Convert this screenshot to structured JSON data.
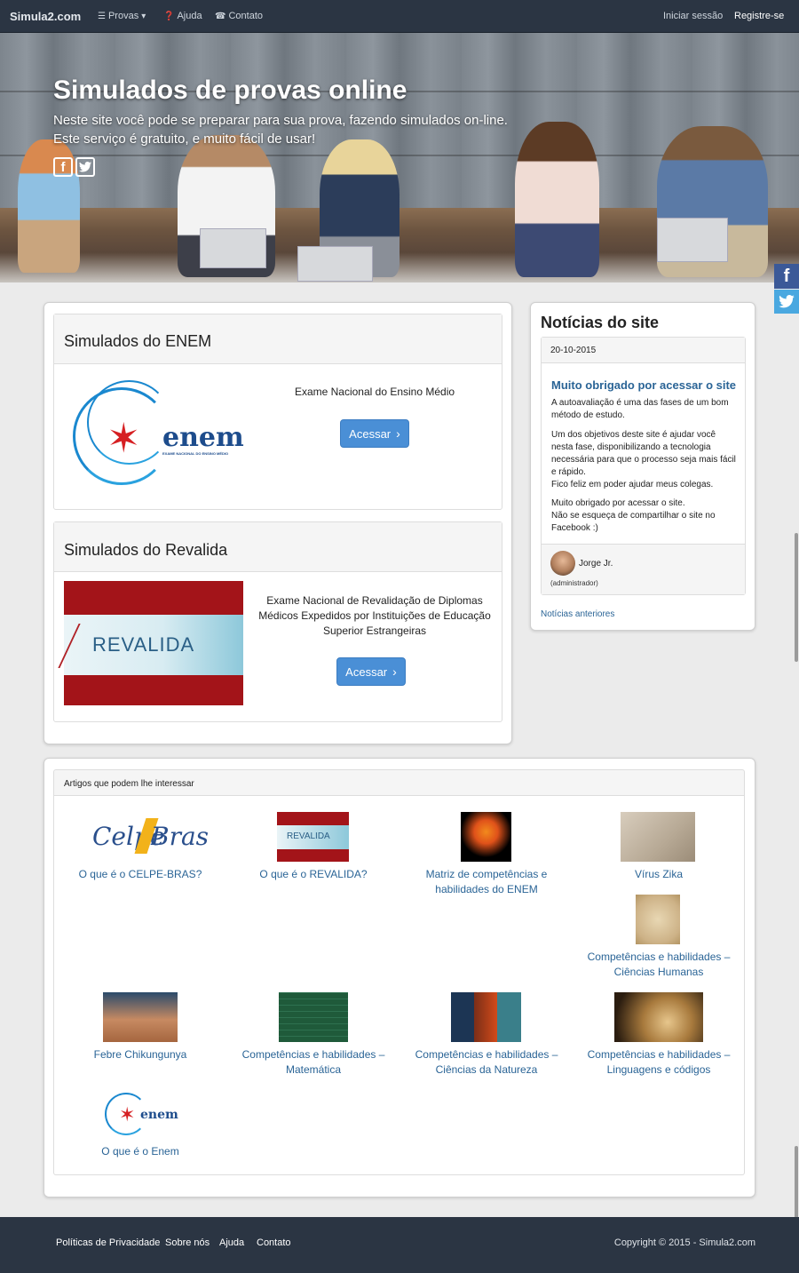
{
  "navbar": {
    "brand": "Simula2.com",
    "provas": "Provas",
    "ajuda": "Ajuda",
    "contato": "Contato",
    "login": "Iniciar sessão",
    "register": "Registre-se"
  },
  "hero": {
    "title": "Simulados de provas online",
    "line1": "Neste site você pode se preparar para sua prova, fazendo simulados on-line.",
    "line2": "Este serviço é gratuito, e muito fácil de usar!",
    "facebook_glyph": "f",
    "twitter_glyph": "🐦"
  },
  "enem_panel": {
    "title": "Simulados do ENEM",
    "description": "Exame Nacional do Ensino Médio",
    "button": "Acessar",
    "logo_text": "enem",
    "logo_subtext": "EXAME NACIONAL DO ENSINO MÉDIO"
  },
  "revalida_panel": {
    "title": "Simulados do Revalida",
    "description_1": "Exame Nacional de Revalidação de Diplomas",
    "description_2": "Médicos Expedidos por Instituições de Educação",
    "description_3": "Superior Estrangeiras",
    "button": "Acessar",
    "logo_text": "REVALIDA"
  },
  "news": {
    "section_title": "Notícias do site",
    "date": "20-10-2015",
    "headline": "Muito obrigado por acessar o site",
    "p1": "A autoavaliação é uma das fases de um bom método de estudo.",
    "p2": "Um dos objetivos deste site é ajudar você nesta fase, disponibilizando a tecnologia necessária para que o processo seja mais fácil e rápido.",
    "p3": "Fico feliz em poder ajudar meus colegas.",
    "p4": "Muito obrigado por acessar o site.",
    "p5": "Não se esqueça de compartilhar o site no Facebook :)",
    "author": "Jorge Jr.",
    "author_role": "(administrador)",
    "previous": "Notícias anteriores"
  },
  "articles": {
    "heading": "Artigos que podem lhe interessar",
    "items": [
      {
        "label": "O que é o CELPE-BRAS?",
        "thumb": "celpe-bras-logo"
      },
      {
        "label": "O que é o REVALIDA?",
        "thumb": "revalida-logo"
      },
      {
        "label_1": "Matriz de competências e",
        "label_2": "habilidades do ENEM",
        "thumb": "brain-head-image"
      },
      {
        "label": "Vírus Zika",
        "thumb": "mosquito-image"
      },
      {
        "label_1": "Competências e habilidades –",
        "label_2": "Ciências Humanas",
        "thumb": "vitruvian-man-image"
      },
      {
        "label": "Febre Chikungunya",
        "thumb": "mosquito-skin-image"
      },
      {
        "label_1": "Competências e habilidades –",
        "label_2": "Matemática",
        "thumb": "chalkboard-image"
      },
      {
        "label_1": "Competências e habilidades –",
        "label_2": "Ciências da Natureza",
        "thumb": "nature-collage-image"
      },
      {
        "label_1": "Competências e habilidades –",
        "label_2": "Linguagens e códigos",
        "thumb": "quill-book-image"
      },
      {
        "label": "O que é o Enem",
        "thumb": "enem-logo"
      }
    ],
    "celpe_word_1": "Celpe",
    "celpe_word_2": "Bras",
    "mini_revalida": "REVALIDA",
    "mini_enem": "enem"
  },
  "footer": {
    "privacy": "Políticas de Privacidade",
    "about": "Sobre nós",
    "help": "Ajuda",
    "contact": "Contato",
    "copyright": "Copyright © 2015 - Simula2.com"
  },
  "colors": {
    "navbar": "#2b3543",
    "link": "#2a6496",
    "button": "#4a8fd6",
    "revalida_red": "#a31419"
  }
}
